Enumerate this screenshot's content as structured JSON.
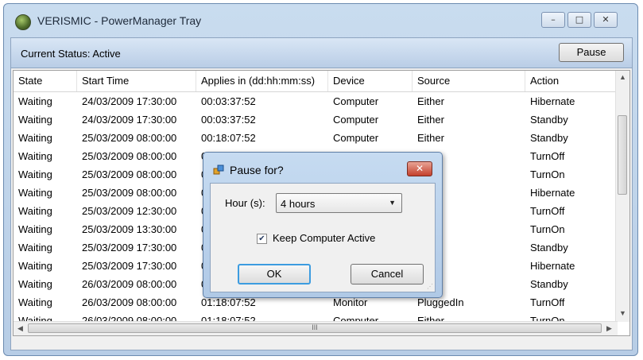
{
  "window": {
    "title": "VERISMIC - PowerManager Tray",
    "controls": {
      "minimize": "–",
      "maximize": "□",
      "close": "✕"
    }
  },
  "status": {
    "text": "Current Status: Active",
    "pause_label": "Pause"
  },
  "table": {
    "columns": [
      "State",
      "Start Time",
      "Applies in (dd:hh:mm:ss)",
      "Device",
      "Source",
      "Action"
    ],
    "rows": [
      [
        "Waiting",
        "24/03/2009 17:30:00",
        "00:03:37:52",
        "Computer",
        "Either",
        "Hibernate"
      ],
      [
        "Waiting",
        "24/03/2009 17:30:00",
        "00:03:37:52",
        "Computer",
        "Either",
        "Standby"
      ],
      [
        "Waiting",
        "25/03/2009 08:00:00",
        "00:18:07:52",
        "Computer",
        "Either",
        "Standby"
      ],
      [
        "Waiting",
        "25/03/2009 08:00:00",
        "0",
        "",
        "dIn",
        "TurnOff"
      ],
      [
        "Waiting",
        "25/03/2009 08:00:00",
        "0",
        "",
        "",
        "TurnOn"
      ],
      [
        "Waiting",
        "25/03/2009 08:00:00",
        "0",
        "",
        "",
        "Hibernate"
      ],
      [
        "Waiting",
        "25/03/2009 12:30:00",
        "0",
        "",
        "",
        "TurnOff"
      ],
      [
        "Waiting",
        "25/03/2009 13:30:00",
        "0",
        "",
        "",
        "TurnOn"
      ],
      [
        "Waiting",
        "25/03/2009 17:30:00",
        "0",
        "",
        "",
        "Standby"
      ],
      [
        "Waiting",
        "25/03/2009 17:30:00",
        "0",
        "",
        "",
        "Hibernate"
      ],
      [
        "Waiting",
        "26/03/2009 08:00:00",
        "0",
        "",
        "",
        "Standby"
      ],
      [
        "Waiting",
        "26/03/2009 08:00:00",
        "01:18:07:52",
        "Monitor",
        "PluggedIn",
        "TurnOff"
      ],
      [
        "Waiting",
        "26/03/2009 08:00:00",
        "01:18:07:52",
        "Computer",
        "Either",
        "TurnOn"
      ]
    ]
  },
  "scrollbar": {
    "hthumb_grip": "III"
  },
  "dialog": {
    "title": "Pause for?",
    "close": "✕",
    "hour_label": "Hour (s):",
    "hour_value": "4 hours",
    "keep_active_label": "Keep Computer Active",
    "keep_active_checked": true,
    "ok_label": "OK",
    "cancel_label": "Cancel"
  }
}
